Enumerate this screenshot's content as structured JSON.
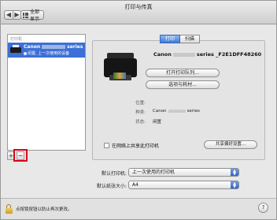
{
  "window": {
    "title": "打印与传真"
  },
  "toolbar": {
    "back": "◀",
    "forward": "▶",
    "show_all": "全部显示"
  },
  "printer_list": {
    "header": "打印机",
    "items": [
      {
        "name_prefix": "Canon",
        "name_suffix": "series",
        "status": "闲置, 上一次使用的设备"
      }
    ],
    "add_label": "+",
    "remove_label": "−"
  },
  "tabs": [
    {
      "label": "打印",
      "active": true
    },
    {
      "label": "扫描",
      "active": false
    }
  ],
  "detail": {
    "name_prefix": "Canon",
    "name_suffix": "series _F2E1DFF48260",
    "open_queue": "打开打印队列...",
    "options_supplies": "选项与耗材...",
    "location_label": "位置:",
    "location_value": "",
    "kind_label": "种类:",
    "kind_prefix": "Canon",
    "kind_suffix": "series",
    "status_label": "状态:",
    "status_value": "闲置"
  },
  "sharing": {
    "share_checkbox_label": "在网络上共享此打印机",
    "share_checked": false,
    "share_prefs_button": "共享偏好设置..."
  },
  "defaults": {
    "default_printer_label": "默认打印机:",
    "default_printer_value": "上一次使用的打印机",
    "default_paper_label": "默认纸张大小:",
    "default_paper_value": "A4"
  },
  "footer": {
    "lock_text": "点按锁按钮以防止再次更改。",
    "help": "?"
  },
  "colors": {
    "selection": "#3d6fd6",
    "highlight_box": "#e0001a",
    "popup_accent": "#2f64c6"
  }
}
